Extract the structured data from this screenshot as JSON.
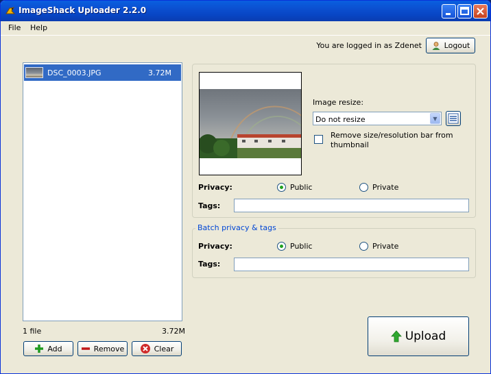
{
  "window": {
    "title": "ImageShack Uploader 2.2.0"
  },
  "menu": {
    "file": "File",
    "help": "Help"
  },
  "login": {
    "text": "You are logged in as Zdenet",
    "logout": "Logout"
  },
  "files": {
    "items": [
      {
        "name": "DSC_0003.JPG",
        "size": "3.72M"
      }
    ],
    "count_text": "1 file",
    "total_size": "3.72M"
  },
  "buttons": {
    "add": "Add",
    "remove": "Remove",
    "clear": "Clear",
    "upload": "Upload"
  },
  "image": {
    "resize_label": "Image resize:",
    "resize_value": "Do not resize",
    "remove_bar_label_line1": "Remove size/resolution bar from",
    "remove_bar_label_line2": "thumbnail",
    "remove_bar_checked": false
  },
  "single": {
    "privacy_label": "Privacy:",
    "public": "Public",
    "private": "Private",
    "selected": "public",
    "tags_label": "Tags:",
    "tags_value": ""
  },
  "batch": {
    "title": "Batch privacy & tags",
    "privacy_label": "Privacy:",
    "public": "Public",
    "private": "Private",
    "selected": "public",
    "tags_label": "Tags:",
    "tags_value": ""
  },
  "colors": {
    "titlebar": "#0a5fe0",
    "selection": "#316ac5",
    "group_title": "#0046d5",
    "upload_arrow": "#2fa82f"
  },
  "icons": {
    "app": "imageshack-frog-icon",
    "logout": "user-icon",
    "add": "plus-icon",
    "remove": "minus-icon",
    "clear": "cancel-icon",
    "upload": "up-arrow-icon",
    "options": "list-icon"
  }
}
